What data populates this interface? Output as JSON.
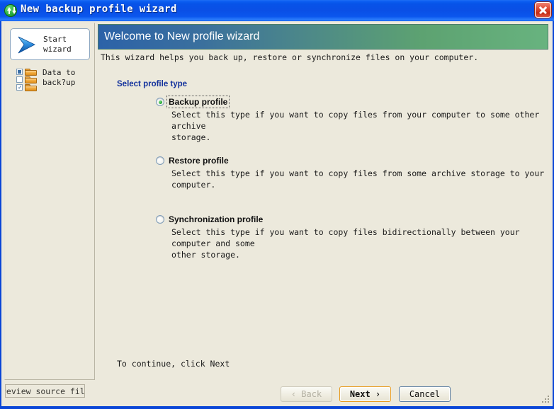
{
  "window": {
    "title": "New backup profile wizard",
    "title_icon": "sync-arrows-green-icon",
    "close_label": "close-icon",
    "titlebar_color": "#0a4fe6",
    "client_bg": "#ECE9DC"
  },
  "sidebar": {
    "items": [
      {
        "label": "Start\nwizard",
        "icon": "blue-chevron-arrow-icon",
        "selected": true
      },
      {
        "label": "Data to\nback?up",
        "icon": "folders-checklist-icon",
        "selected": false
      }
    ]
  },
  "content": {
    "banner_title": "Welcome to New profile wizard",
    "banner_gradient_from": "#2c62a8",
    "banner_gradient_to": "#68b37f",
    "intro": "This wizard helps you back up, restore or synchronize files on your computer.",
    "section_title": "Select profile type",
    "section_title_color": "#12319c",
    "options": [
      {
        "label": "Backup profile",
        "description": "Select this type if you want to copy files from your computer to some other  archive\nstorage.",
        "selected": true,
        "focused": true
      },
      {
        "label": "Restore profile",
        "description": "Select this type if you want to copy files from some archive storage to your computer.",
        "selected": false,
        "focused": false
      },
      {
        "label": "Synchronization profile",
        "description": "Select this type if you want to copy files bidirectionally between your computer and some\nother storage.",
        "selected": false,
        "focused": false
      }
    ],
    "continue_note": "To continue, click Next"
  },
  "status_field": {
    "text": "review source file",
    "clipped": true
  },
  "footer": {
    "back_label": "‹ Back",
    "back_enabled": false,
    "next_label": "Next ›",
    "next_default": true,
    "cancel_label": "Cancel",
    "next_accent": "#e89a1c"
  }
}
